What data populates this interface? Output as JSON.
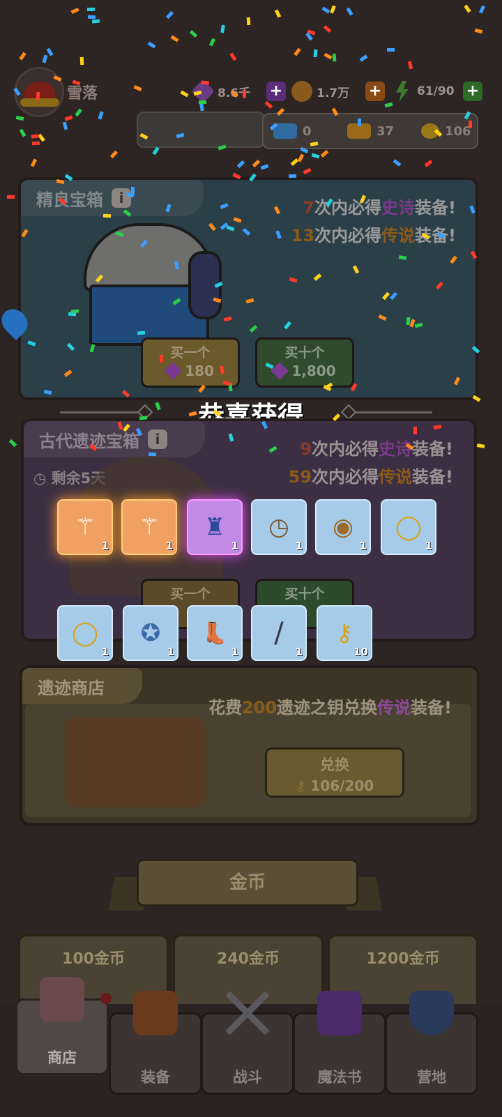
{
  "player": {
    "name": "雪落"
  },
  "resources": [
    {
      "name": "gem",
      "value": "8.6千",
      "icon_color": "#6b3c84",
      "plus_color": "#5a2e7a"
    },
    {
      "name": "coin",
      "value": "1.7万",
      "icon_color": "#8a5a1c",
      "plus_color": "#8a4a16"
    },
    {
      "name": "energy",
      "value": "61/90",
      "icon_color": "#3c7a2c",
      "plus_color": "#2e6a28"
    }
  ],
  "subbar": [
    {
      "name": "blue-ticket",
      "value": "0",
      "icon_color": "#2f6aa0"
    },
    {
      "name": "gold-ticket",
      "value": "37",
      "icon_color": "#9a6a18"
    },
    {
      "name": "key",
      "value": "106",
      "icon_color": "#9a7a18"
    }
  ],
  "fine_chest": {
    "title": "精良宝箱",
    "line1_num": "7",
    "line1_text": "次内必得",
    "line1_rarity": "史诗",
    "line1_suffix": "装备!",
    "line2_num": "13",
    "line2_text": "次内必得",
    "line2_rarity": "传说",
    "line2_suffix": "装备!",
    "buy_one": "买一个",
    "buy_one_price": "180",
    "buy_ten": "买十个",
    "buy_ten_price": "1,800"
  },
  "congrats": "恭喜获得",
  "ancient_chest": {
    "title": "古代遗迹宝箱",
    "line1_num": "9",
    "line1_text": "次内必得",
    "line1_rarity": "史诗",
    "line1_suffix": "装备!",
    "line2_num": "59",
    "line2_text": "次内必得",
    "line2_rarity": "传说",
    "line2_suffix": "装备!",
    "remaining": "剩余5天",
    "buy_one": "买一个",
    "buy_ten": "买十个"
  },
  "rewards_row1": [
    {
      "name": "staff",
      "count": "1",
      "rarity": "orange",
      "glyph": "⚚"
    },
    {
      "name": "staff",
      "count": "1",
      "rarity": "orange",
      "glyph": "⚚"
    },
    {
      "name": "cloak",
      "count": "1",
      "rarity": "purple",
      "glyph": "♜"
    },
    {
      "name": "pocket-watch",
      "count": "1",
      "rarity": "blue",
      "glyph": "◷"
    },
    {
      "name": "amulet",
      "count": "1",
      "rarity": "blue",
      "glyph": "◉"
    },
    {
      "name": "ring",
      "count": "1",
      "rarity": "blue",
      "glyph": "◯"
    }
  ],
  "rewards_row2": [
    {
      "name": "ring",
      "count": "1",
      "rarity": "blue",
      "glyph": "◯"
    },
    {
      "name": "badge",
      "count": "1",
      "rarity": "blue",
      "glyph": "✪"
    },
    {
      "name": "boots",
      "count": "1",
      "rarity": "blue",
      "glyph": "👢"
    },
    {
      "name": "spear",
      "count": "1",
      "rarity": "blue",
      "glyph": "/"
    },
    {
      "name": "key",
      "count": "10",
      "rarity": "blue",
      "glyph": "⚷"
    }
  ],
  "relic_shop": {
    "title": "遗迹商店",
    "desc_a": "花费",
    "desc_num": "200",
    "desc_b": "遗迹之钥兑换",
    "desc_rarity": "传说",
    "desc_c": "装备!",
    "exchange_label": "兑换",
    "exchange_progress": "106/200"
  },
  "coins_section": {
    "title": "金币",
    "cards": [
      "100金币",
      "240金币",
      "1200金币"
    ]
  },
  "nav": [
    {
      "label": "商店",
      "icon": "shop-icon",
      "selected": true
    },
    {
      "label": "装备",
      "icon": "backpack-icon"
    },
    {
      "label": "战斗",
      "icon": "swords-icon"
    },
    {
      "label": "魔法书",
      "icon": "spellbook-icon"
    },
    {
      "label": "营地",
      "icon": "shield-crown-icon"
    }
  ],
  "colors": {
    "epic": "#b04ad0",
    "legendary": "#d88a1a",
    "number": "#d04a2a"
  }
}
